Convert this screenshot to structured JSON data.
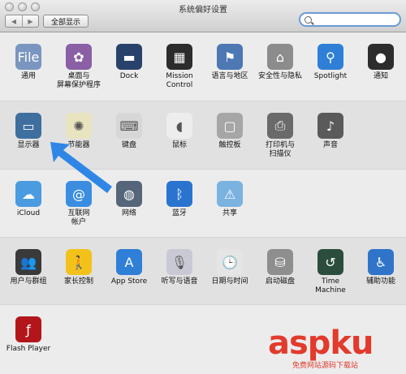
{
  "window": {
    "title": "系统偏好设置"
  },
  "toolbar": {
    "back": "◀",
    "forward": "▶",
    "show_all_label": "全部显示",
    "search_value": "",
    "search_placeholder": ""
  },
  "rows": [
    {
      "panes": [
        {
          "label": "通用",
          "icon": "general-icon",
          "color": "#7a96c0",
          "glyph": "File"
        },
        {
          "label": "桌面与\n屏幕保护程序",
          "icon": "desktop-icon",
          "color": "#8a5fa6",
          "glyph": "✿"
        },
        {
          "label": "Dock",
          "icon": "dock-icon",
          "color": "#29426b",
          "glyph": "▬"
        },
        {
          "label": "Mission\nControl",
          "icon": "mission-control-icon",
          "color": "#2c2c2c",
          "glyph": "▦"
        },
        {
          "label": "语言与地区",
          "icon": "flag-icon",
          "color": "#4d78b3",
          "glyph": "⚑"
        },
        {
          "label": "安全性与隐私",
          "icon": "house-lock-icon",
          "color": "#8c8c8c",
          "glyph": "⌂"
        },
        {
          "label": "Spotlight",
          "icon": "spotlight-icon",
          "color": "#2f7fd6",
          "glyph": "⚲"
        },
        {
          "label": "通知",
          "icon": "notifications-icon",
          "color": "#2d2d2d",
          "glyph": "●"
        }
      ]
    },
    {
      "panes": [
        {
          "label": "显示器",
          "icon": "display-icon",
          "color": "#3f6f9e",
          "glyph": "▭"
        },
        {
          "label": "节能器",
          "icon": "bulb-icon",
          "color": "#e9e4c0",
          "glyph": "✺"
        },
        {
          "label": "键盘",
          "icon": "keyboard-icon",
          "color": "#d7d7d7",
          "glyph": "⌨"
        },
        {
          "label": "鼠标",
          "icon": "mouse-icon",
          "color": "#ededed",
          "glyph": "◖"
        },
        {
          "label": "触控板",
          "icon": "trackpad-icon",
          "color": "#a6a6a6",
          "glyph": "▢"
        },
        {
          "label": "打印机与\n扫描仪",
          "icon": "printer-icon",
          "color": "#6a6a6a",
          "glyph": "⎙"
        },
        {
          "label": "声音",
          "icon": "speaker-icon",
          "color": "#5a5a5a",
          "glyph": "♪"
        }
      ]
    },
    {
      "panes": [
        {
          "label": "iCloud",
          "icon": "icloud-icon",
          "color": "#4a9be0",
          "glyph": "☁"
        },
        {
          "label": "互联网\n帐户",
          "icon": "internet-accounts-icon",
          "color": "#3b8de0",
          "glyph": "@"
        },
        {
          "label": "网络",
          "icon": "network-icon",
          "color": "#55657a",
          "glyph": "◍"
        },
        {
          "label": "蓝牙",
          "icon": "bluetooth-icon",
          "color": "#2a74d0",
          "glyph": "ᛒ"
        },
        {
          "label": "共享",
          "icon": "sharing-icon",
          "color": "#7ab2e0",
          "glyph": "⚠"
        }
      ]
    },
    {
      "panes": [
        {
          "label": "用户与群组",
          "icon": "users-icon",
          "color": "#3a3a3a",
          "glyph": "👥"
        },
        {
          "label": "家长控制",
          "icon": "parental-controls-icon",
          "color": "#f2c21b",
          "glyph": "🚶"
        },
        {
          "label": "App Store",
          "icon": "app-store-icon",
          "color": "#2f7fd6",
          "glyph": "A"
        },
        {
          "label": "听写与语音",
          "icon": "microphone-icon",
          "color": "#c9c9d6",
          "glyph": "🎙"
        },
        {
          "label": "日期与时间",
          "icon": "clock-icon",
          "color": "#e5e5e5",
          "glyph": "🕒"
        },
        {
          "label": "启动磁盘",
          "icon": "disk-icon",
          "color": "#8e8e8e",
          "glyph": "⛁"
        },
        {
          "label": "Time Machine",
          "icon": "time-machine-icon",
          "color": "#2c4d3c",
          "glyph": "↺"
        },
        {
          "label": "辅助功能",
          "icon": "accessibility-icon",
          "color": "#2f74c9",
          "glyph": "♿"
        }
      ]
    },
    {
      "panes": [
        {
          "label": "Flash Player",
          "icon": "flash-player-icon",
          "color": "#b2161b",
          "glyph": "ƒ"
        }
      ]
    }
  ],
  "watermark": {
    "main": "aspku",
    "domain_tld": ".com",
    "sub": "免费网站源码下载站"
  }
}
